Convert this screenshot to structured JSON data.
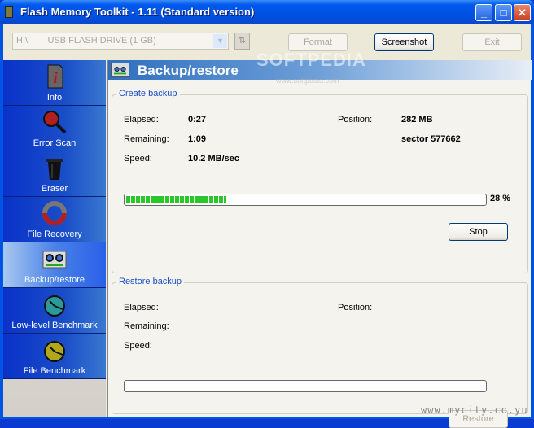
{
  "window": {
    "title": "Flash Memory Toolkit - 1.11 (Standard version)",
    "minimize": "_",
    "maximize": "□",
    "close": "✕"
  },
  "toolbar": {
    "drive_select": "H:\\        USB FLASH DRIVE (1 GB)",
    "format": "Format",
    "screenshot": "Screenshot",
    "exit": "Exit"
  },
  "sidebar": {
    "items": [
      {
        "label": "Info",
        "icon": "info-icon"
      },
      {
        "label": "Error Scan",
        "icon": "magnifier-icon"
      },
      {
        "label": "Eraser",
        "icon": "trash-icon"
      },
      {
        "label": "File Recovery",
        "icon": "lifebuoy-icon"
      },
      {
        "label": "Backup/restore",
        "icon": "tape-icon",
        "selected": true
      },
      {
        "label": "Low-level Benchmark",
        "icon": "stopwatch-icon"
      },
      {
        "label": "File Benchmark",
        "icon": "stopwatch-icon"
      }
    ]
  },
  "main": {
    "title": "Backup/restore",
    "create": {
      "legend": "Create backup",
      "elapsed_label": "Elapsed:",
      "elapsed": "0:27",
      "remaining_label": "Remaining:",
      "remaining": "1:09",
      "speed_label": "Speed:",
      "speed": "10.2 MB/sec",
      "position_label": "Position:",
      "position": "282 MB",
      "sector": "sector 577662",
      "progress": 28,
      "progress_text": "28 %",
      "stop": "Stop"
    },
    "restore": {
      "legend": "Restore backup",
      "elapsed_label": "Elapsed:",
      "remaining_label": "Remaining:",
      "speed_label": "Speed:",
      "position_label": "Position:",
      "progress": 0,
      "restore": "Restore"
    }
  },
  "watermarks": {
    "softpedia": "SOFTPEDIA",
    "softpedia_url": "www.softpedia.com",
    "mycity": "www.mycity.co.yu"
  }
}
